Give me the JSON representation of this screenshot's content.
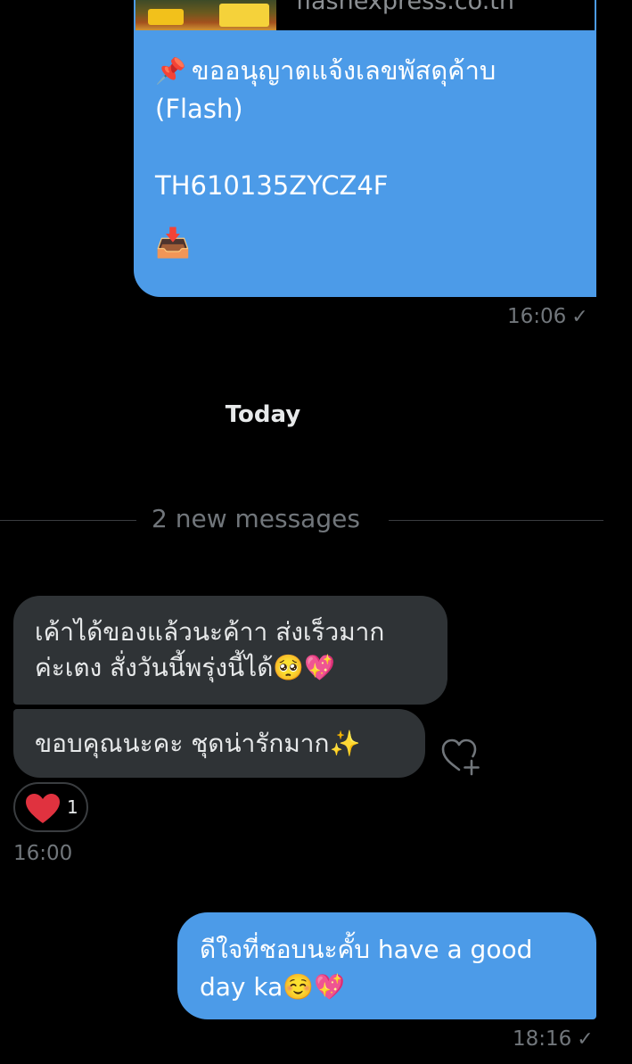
{
  "link_preview": {
    "domain": "flashexpress.co.th"
  },
  "outgoing_message_1": {
    "pin_emoji": "📌",
    "line1": "ขออนุญาตแจ้งเลขพัสดุค้าบ",
    "line2": "(Flash)",
    "tracking": "TH610135ZYCZ4F",
    "tray_emoji": "📥",
    "time": "16:06"
  },
  "date_label": "Today",
  "new_messages_divider": "2 new messages",
  "incoming_message_1": {
    "line1": "เค้าได้ของแล้วนะค้าา ส่งเร็วมาก",
    "line2": "ค่ะเตง สั่งวันนี้พรุ่งนี้ได้🥺💖"
  },
  "incoming_message_2": {
    "text": "ขอบคุณนะคะ ชุดน่ารักมาก✨"
  },
  "reaction": {
    "icon": "heart-icon",
    "count": "1"
  },
  "incoming_time": "16:00",
  "outgoing_message_2": {
    "line1": "ดีใจที่ชอบนะคั้บ have a good",
    "line2": "day ka☺️💖",
    "time": "18:16"
  },
  "check_mark": "✓",
  "colors": {
    "background": "#000000",
    "outgoing_bubble": "#4c9be8",
    "incoming_bubble": "#2f3336",
    "muted_text": "#71767b",
    "reaction_heart": "#e0323f"
  }
}
